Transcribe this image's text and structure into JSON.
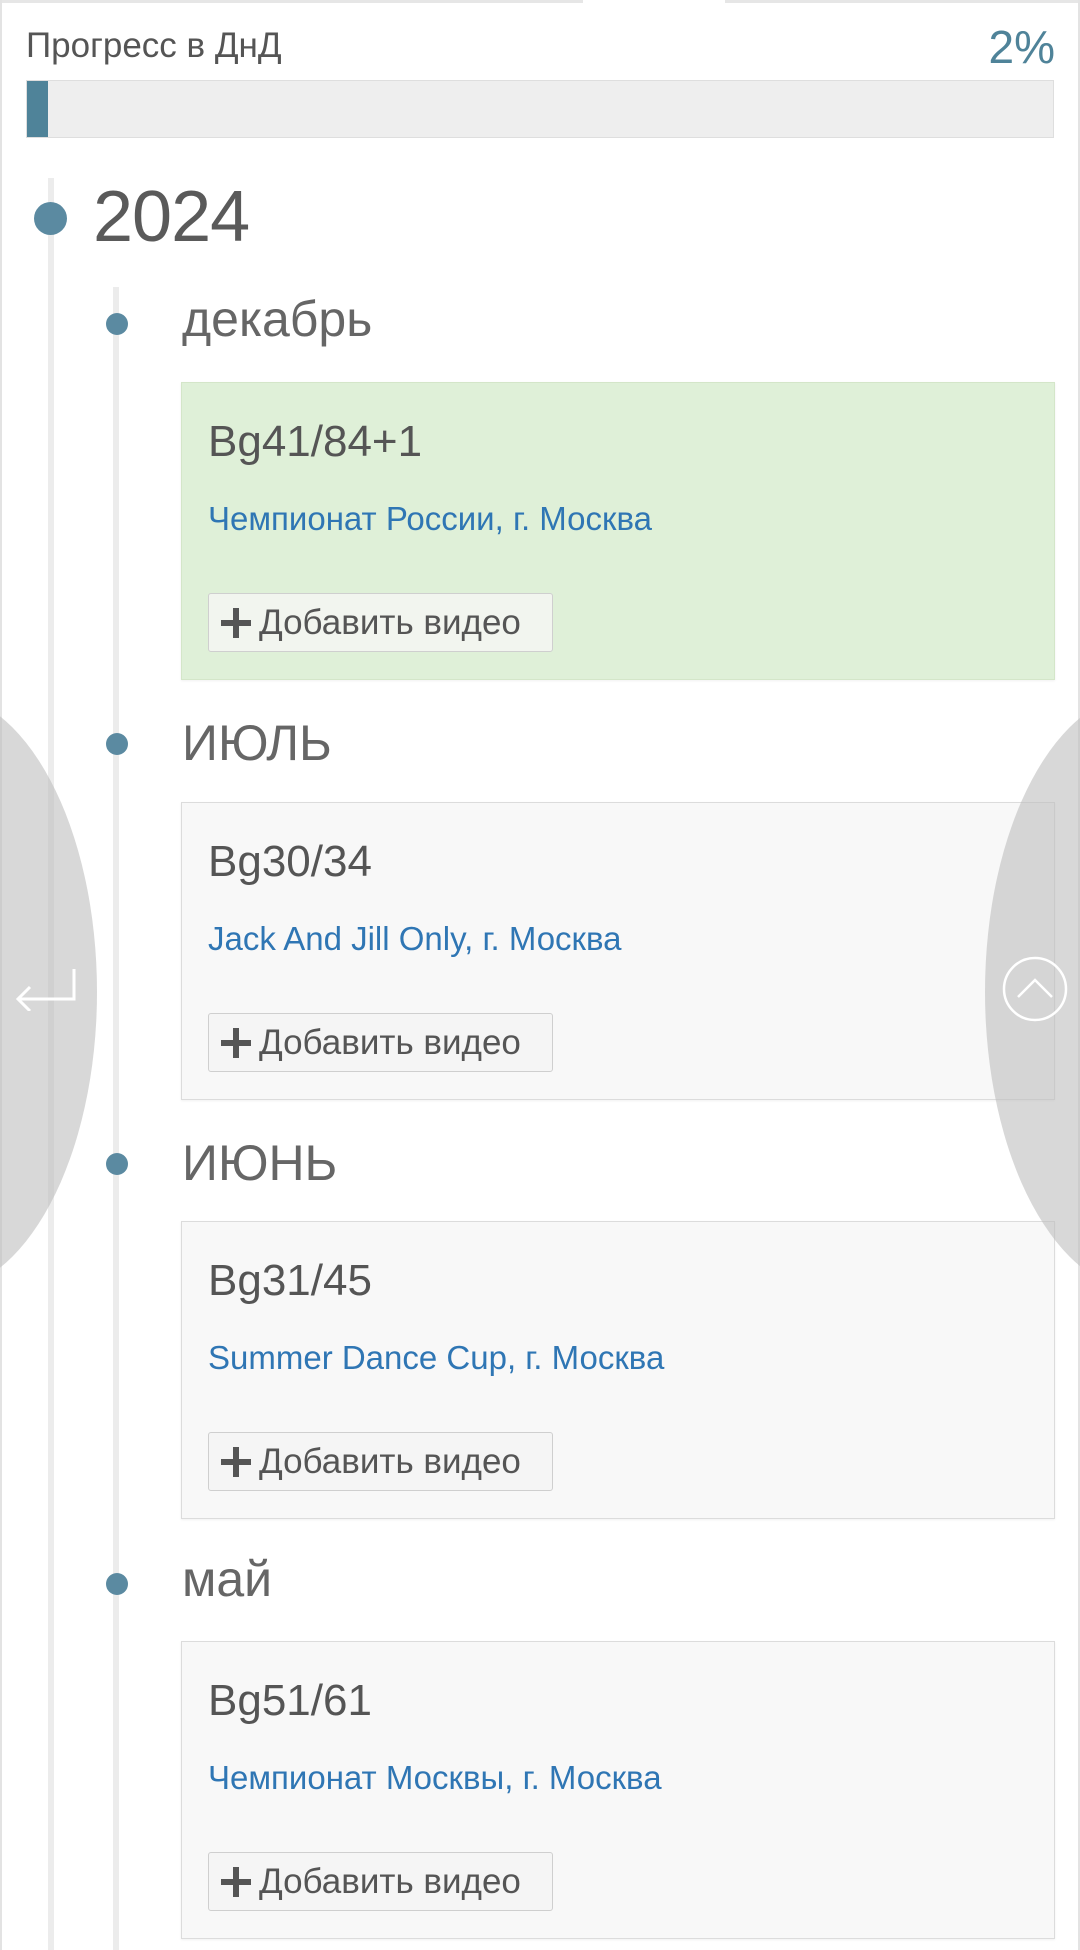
{
  "progress": {
    "label": "Прогресс в ДнД",
    "value_text": "2%",
    "fraction": 0.02,
    "accent_color": "#4f8399"
  },
  "timeline": {
    "year": "2024",
    "months": [
      {
        "label": "декабрь",
        "entry": {
          "title": "Bg41/84+1",
          "event": "Чемпионат России, г. Москва",
          "add_video_label": "Добавить видео",
          "highlight": true
        }
      },
      {
        "label": "ИЮЛЬ",
        "entry": {
          "title": "Bg30/34",
          "event": "Jack And Jill Only, г. Москва",
          "add_video_label": "Добавить видео",
          "highlight": false
        }
      },
      {
        "label": "ИЮНЬ",
        "entry": {
          "title": "Bg31/45",
          "event": "Summer Dance Cup, г. Москва",
          "add_video_label": "Добавить видео",
          "highlight": false
        }
      },
      {
        "label": "май",
        "entry": {
          "title": "Bg51/61",
          "event": "Чемпионат Москвы, г. Москва",
          "add_video_label": "Добавить видео",
          "highlight": false
        }
      }
    ]
  },
  "overlay": {
    "left_icon": "return-arrow-icon",
    "right_icon": "scroll-up-icon"
  },
  "colors": {
    "highlight_card": "#dff0d8",
    "default_card": "#f8f8f8",
    "link": "#2f76b4",
    "dot": "#5b8aa1"
  }
}
